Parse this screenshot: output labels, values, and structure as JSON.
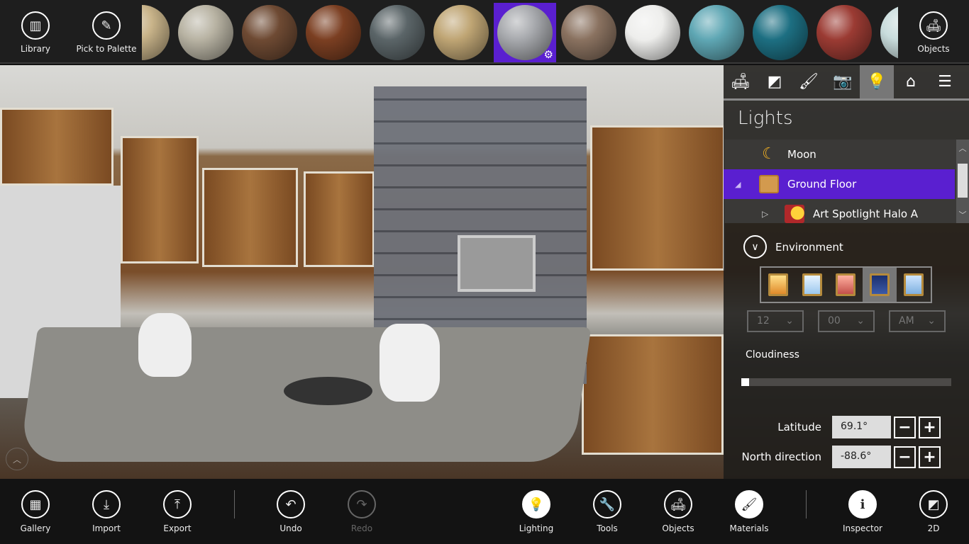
{
  "topbar": {
    "library": "Library",
    "pick": "Pick to Palette",
    "objects": "Objects",
    "materials": [
      {
        "color": "#c9b48a",
        "selected": false
      },
      {
        "color": "#b8b3a3",
        "selected": false
      },
      {
        "color": "#6e4a33",
        "selected": false
      },
      {
        "color": "#7b3f22",
        "selected": false
      },
      {
        "color": "#5b6568",
        "selected": false
      },
      {
        "color": "#bfa574",
        "selected": false
      },
      {
        "color": "#a7a9ad",
        "selected": true
      },
      {
        "color": "#8a7260",
        "selected": false
      },
      {
        "color": "#eeeeec",
        "selected": false
      },
      {
        "color": "#5fa7b4",
        "selected": false
      },
      {
        "color": "#1d6f82",
        "selected": false
      },
      {
        "color": "#9b3b33",
        "selected": false
      },
      {
        "color": "#c8dcdc",
        "selected": false
      }
    ]
  },
  "panel": {
    "tabs": [
      {
        "name": "furniture-icon",
        "glyph": "🛋"
      },
      {
        "name": "floorplan-icon",
        "glyph": "◩"
      },
      {
        "name": "brush-icon",
        "glyph": "🖌"
      },
      {
        "name": "camera-icon",
        "glyph": "📷"
      },
      {
        "name": "lightbulb-icon",
        "glyph": "💡",
        "active": true
      },
      {
        "name": "home-icon",
        "glyph": "⌂"
      },
      {
        "name": "list-icon",
        "glyph": "☰"
      }
    ],
    "title": "Lights",
    "tree": [
      {
        "label": "Moon",
        "icon": "moon-icon"
      },
      {
        "label": "Ground Floor",
        "icon": "floor-icon",
        "selected": true,
        "expanded": true
      },
      {
        "label": "Art Spotlight Halo A",
        "icon": "spotlight-icon"
      }
    ],
    "environment": "Environment",
    "presets": [
      "morning",
      "day",
      "evening",
      "night",
      "custom-time"
    ],
    "active_preset": "night",
    "hour": "12",
    "minute": "00",
    "ampm": "AM",
    "cloudiness_label": "Cloudiness",
    "cloudiness": 0,
    "latitude_label": "Latitude",
    "latitude": "69.1°",
    "north_label": "North direction",
    "north": "-88.6°"
  },
  "bottombar": {
    "gallery": "Gallery",
    "import": "Import",
    "export": "Export",
    "undo": "Undo",
    "redo": "Redo",
    "lighting": "Lighting",
    "tools": "Tools",
    "objects": "Objects",
    "materials": "Materials",
    "inspector": "Inspector",
    "twod": "2D"
  }
}
